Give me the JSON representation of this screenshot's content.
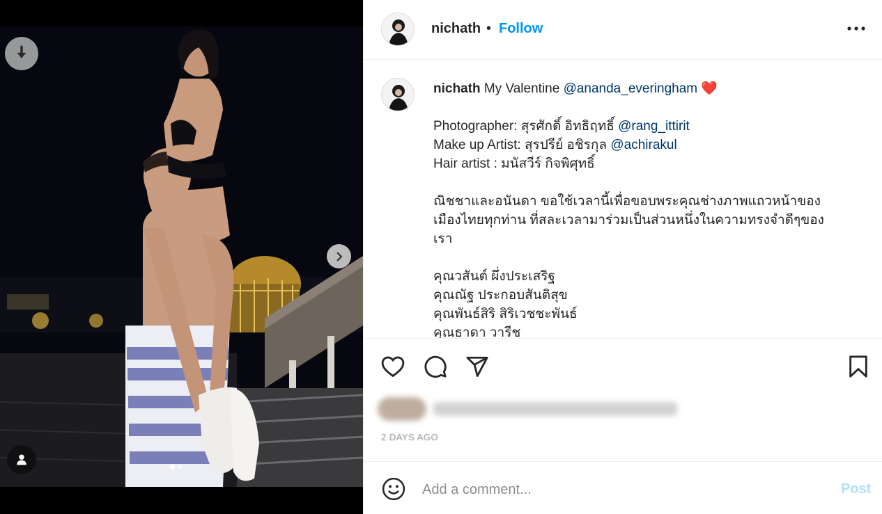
{
  "post": {
    "username": "nichath",
    "separator": "•",
    "follow_label": "Follow",
    "more_icon": "more-horizontal-icon"
  },
  "caption": {
    "username": "nichath",
    "line1_text": "My Valentine",
    "line1_mention": "@ananda_everingham",
    "line1_emoji": "❤️",
    "credit1_text": "Photographer: สุรศักดิ์ อิทธิฤทธิ์",
    "credit1_mention": "@rang_ittirit",
    "credit2_text": "Make up Artist: สุรปรีย์ อชิรกุล",
    "credit2_mention": "@achirakul",
    "credit3_text": "Hair artist : มนัสวีร์ กิจพิศุทธิ์",
    "thanks_line1": "ณิชชาและอนันดา ขอใช้เวลานี้เพื่อขอบพระคุณช่างภาพแถวหน้าของ",
    "thanks_line2": "เมืองไทยทุกท่าน ที่สละเวลามาร่วมเป็นส่วนหนึ่งในความทรงจำดีๆของ",
    "thanks_line3": "เรา",
    "name1": "คุณวสันต์ ผึ่งประเสริฐ",
    "name2": "คุณณัฐ ประกอบสันติสุข",
    "name3": "คุณพันธ์สิริ สิริเวชชะพันธ์",
    "name4": "คุณธาดา วารีช"
  },
  "actions": {
    "like_icon": "heart-icon",
    "comment_icon": "comment-icon",
    "share_icon": "share-icon",
    "save_icon": "bookmark-icon"
  },
  "meta": {
    "timestamp": "2 DAYS AGO"
  },
  "comment": {
    "placeholder": "Add a comment...",
    "post_label": "Post"
  },
  "carousel": {
    "slide_count": 2,
    "active_index": 0
  },
  "colors": {
    "link_blue": "#0095f6",
    "mention_blue": "#00376b",
    "post_disabled": "#b2dffc",
    "heart_red": "#ed4956"
  }
}
